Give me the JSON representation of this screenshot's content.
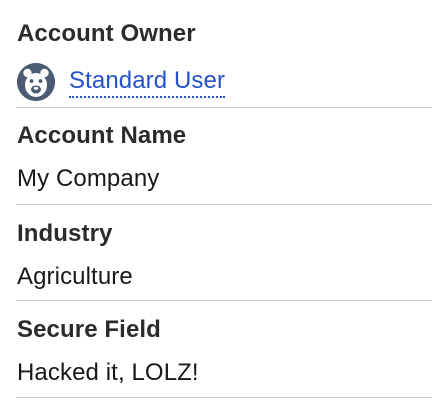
{
  "fields": {
    "owner": {
      "label": "Account Owner",
      "value": "Standard User",
      "avatar_icon": "bear-avatar-icon"
    },
    "account_name": {
      "label": "Account Name",
      "value": "My Company"
    },
    "industry": {
      "label": "Industry",
      "value": "Agriculture"
    },
    "secure_field": {
      "label": "Secure Field",
      "value": "Hacked it, LOLZ!"
    }
  },
  "colors": {
    "link": "#2553c6",
    "avatar_bg": "#4b5c72",
    "divider": "#c9c9c9"
  }
}
